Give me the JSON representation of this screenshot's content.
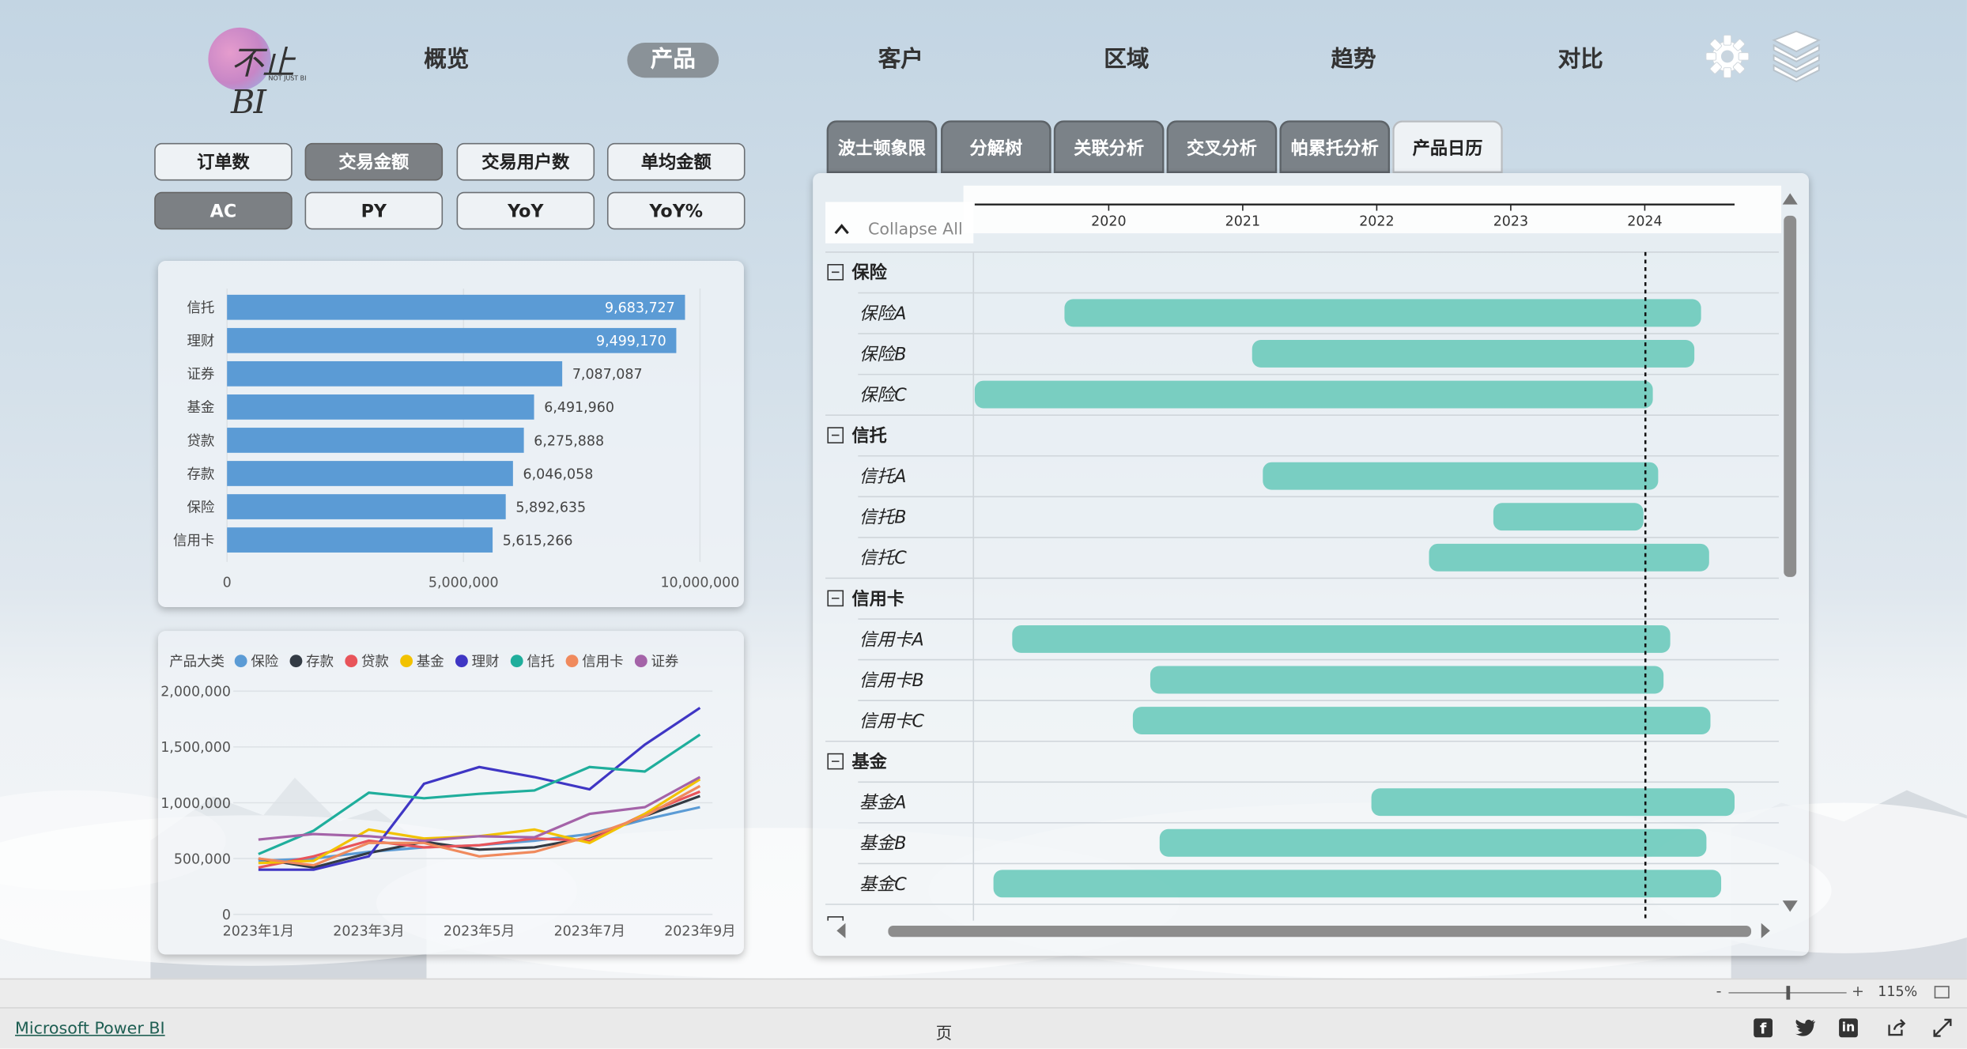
{
  "nav": {
    "logo_text": "不止BI",
    "logo_sub": "NOT JUST BI",
    "items": [
      "概览",
      "产品",
      "客户",
      "区域",
      "趋势",
      "对比"
    ],
    "active": "产品"
  },
  "metric_buttons": [
    {
      "label": "订单数",
      "selected": false
    },
    {
      "label": "交易金额",
      "selected": true
    },
    {
      "label": "交易用户数",
      "selected": false
    },
    {
      "label": "单均金额",
      "selected": false
    }
  ],
  "compare_buttons": [
    {
      "label": "AC",
      "selected": true
    },
    {
      "label": "PY",
      "selected": false
    },
    {
      "label": "YoY",
      "selected": false
    },
    {
      "label": "YoY%",
      "selected": false
    }
  ],
  "tabs": [
    {
      "label": "波士顿象限",
      "active": false
    },
    {
      "label": "分解树",
      "active": false
    },
    {
      "label": "关联分析",
      "active": false
    },
    {
      "label": "交叉分析",
      "active": false
    },
    {
      "label": "帕累托分析",
      "active": false
    },
    {
      "label": "产品日历",
      "active": true
    }
  ],
  "bar_chart": {
    "chart_data": {
      "type": "bar",
      "orientation": "horizontal",
      "categories": [
        "信托",
        "理财",
        "证券",
        "基金",
        "贷款",
        "存款",
        "保险",
        "信用卡"
      ],
      "values": [
        9683727,
        9499170,
        7087087,
        6491960,
        6275888,
        6046058,
        5892635,
        5615266
      ],
      "value_labels": [
        "9,683,727",
        "9,499,170",
        "7,087,087",
        "6,491,960",
        "6,275,888",
        "6,046,058",
        "5,892,635",
        "5,615,266"
      ],
      "x_ticks": [
        "0",
        "5,000,000",
        "10,000,000"
      ],
      "xlim": [
        0,
        10000000
      ],
      "color": "#5b9bd5"
    }
  },
  "line_chart": {
    "chart_data": {
      "type": "line",
      "legend_title": "产品大类",
      "x": [
        "2023年1月",
        "2023年2月",
        "2023年3月",
        "2023年4月",
        "2023年5月",
        "2023年6月",
        "2023年7月",
        "2023年8月",
        "2023年9月"
      ],
      "x_ticks": [
        "2023年1月",
        "2023年3月",
        "2023年5月",
        "2023年7月",
        "2023年9月"
      ],
      "y_ticks": [
        "0",
        "500,000",
        "1,000,000",
        "1,500,000",
        "2,000,000"
      ],
      "ylim": [
        0,
        2000000
      ],
      "series": [
        {
          "name": "保险",
          "color": "#5b9bd5",
          "values": [
            480000,
            500000,
            560000,
            600000,
            620000,
            660000,
            720000,
            850000,
            960000
          ]
        },
        {
          "name": "存款",
          "color": "#333b44",
          "values": [
            500000,
            420000,
            550000,
            650000,
            580000,
            600000,
            690000,
            880000,
            1060000
          ]
        },
        {
          "name": "贷款",
          "color": "#e8545a",
          "values": [
            420000,
            520000,
            660000,
            600000,
            620000,
            680000,
            660000,
            900000,
            1100000
          ]
        },
        {
          "name": "基金",
          "color": "#f2c200",
          "values": [
            460000,
            480000,
            760000,
            680000,
            700000,
            760000,
            640000,
            900000,
            1210000
          ]
        },
        {
          "name": "理财",
          "color": "#3f36c4",
          "values": [
            400000,
            400000,
            520000,
            1170000,
            1320000,
            1230000,
            1120000,
            1520000,
            1850000
          ]
        },
        {
          "name": "信托",
          "color": "#1fae9c",
          "values": [
            540000,
            750000,
            1090000,
            1040000,
            1080000,
            1110000,
            1320000,
            1280000,
            1610000
          ]
        },
        {
          "name": "信用卡",
          "color": "#f08a5d",
          "values": [
            500000,
            440000,
            640000,
            640000,
            520000,
            560000,
            700000,
            880000,
            1150000
          ]
        },
        {
          "name": "证券",
          "color": "#a463a8",
          "values": [
            670000,
            720000,
            700000,
            660000,
            700000,
            690000,
            900000,
            960000,
            1230000
          ]
        }
      ]
    }
  },
  "gantt": {
    "collapse_label": "Collapse All",
    "years": [
      "2020",
      "2021",
      "2022",
      "2023",
      "2024"
    ],
    "today_line": "2024",
    "chart_data": {
      "type": "gantt",
      "xlim": [
        2019.0,
        2025.0
      ],
      "groups": [
        {
          "name": "保险",
          "items": [
            {
              "name": "保险A",
              "start": 2019.67,
              "end": 2024.42
            },
            {
              "name": "保险B",
              "start": 2021.07,
              "end": 2024.37
            },
            {
              "name": "保险C",
              "start": 2019.0,
              "end": 2024.06
            }
          ]
        },
        {
          "name": "信托",
          "items": [
            {
              "name": "信托A",
              "start": 2021.15,
              "end": 2024.1
            },
            {
              "name": "信托B",
              "start": 2022.87,
              "end": 2023.99
            },
            {
              "name": "信托C",
              "start": 2022.39,
              "end": 2024.48
            }
          ]
        },
        {
          "name": "信用卡",
          "items": [
            {
              "name": "信用卡A",
              "start": 2019.28,
              "end": 2024.19
            },
            {
              "name": "信用卡B",
              "start": 2020.31,
              "end": 2024.14
            },
            {
              "name": "信用卡C",
              "start": 2020.18,
              "end": 2024.49
            }
          ]
        },
        {
          "name": "基金",
          "items": [
            {
              "name": "基金A",
              "start": 2021.96,
              "end": 2024.67
            },
            {
              "name": "基金B",
              "start": 2020.38,
              "end": 2024.46
            },
            {
              "name": "基金C",
              "start": 2019.14,
              "end": 2024.57
            }
          ]
        }
      ]
    }
  },
  "footer": {
    "link": "Microsoft Power BI",
    "page_label": "页",
    "zoom": "115%",
    "zoom_minus": "-",
    "zoom_plus": "+"
  }
}
